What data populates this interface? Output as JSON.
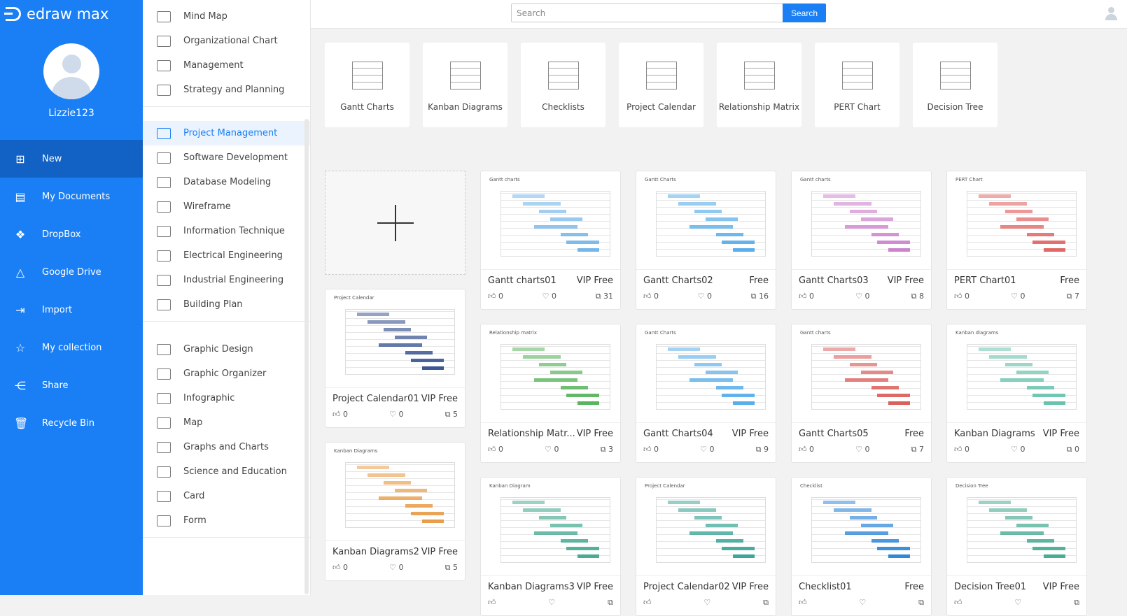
{
  "app": {
    "logo": "edraw max",
    "username": "Lizzie123"
  },
  "nav": [
    {
      "label": "New",
      "icon": "new-file-icon",
      "active": true
    },
    {
      "label": "My Documents",
      "icon": "documents-icon"
    },
    {
      "label": "DropBox",
      "icon": "dropbox-icon"
    },
    {
      "label": "Google Drive",
      "icon": "google-drive-icon"
    },
    {
      "label": "Import",
      "icon": "import-icon"
    },
    {
      "label": "My collection",
      "icon": "star-icon"
    },
    {
      "label": "Share",
      "icon": "share-icon"
    },
    {
      "label": "Recycle Bin",
      "icon": "trash-icon"
    }
  ],
  "categories": [
    [
      "Mind Map",
      "Organizational Chart",
      "Management",
      "Strategy and Planning"
    ],
    [
      "Project Management",
      "Software Development",
      "Database Modeling",
      "Wireframe",
      "Information Technique",
      "Electrical Engineering",
      "Industrial Engineering",
      "Building Plan"
    ],
    [
      "Graphic Design",
      "Graphic Organizer",
      "Infographic",
      "Map",
      "Graphs and Charts",
      "Science and Education",
      "Card",
      "Form"
    ]
  ],
  "active_category": "Project Management",
  "search": {
    "placeholder": "Search",
    "button": "Search"
  },
  "types": [
    "Gantt Charts",
    "Kanban Diagrams",
    "Checklists",
    "Project Calendar",
    "Relationship Matrix",
    "PERT Chart",
    "Decision Tree"
  ],
  "columns": [
    [
      {
        "name": "Project Calendar01",
        "tier": "VIP Free",
        "likes": "0",
        "favs": "0",
        "copies": "5",
        "thumb": "Project Calendar",
        "accent": "#2d4a8a"
      },
      {
        "name": "Kanban Diagrams2",
        "tier": "VIP Free",
        "likes": "0",
        "favs": "0",
        "copies": "5",
        "thumb": "Kanban Diagrams",
        "accent": "#e8963a"
      }
    ],
    [
      {
        "name": "Gantt charts01",
        "tier": "VIP Free",
        "likes": "0",
        "favs": "0",
        "copies": "31",
        "thumb": "Gantt charts",
        "accent": "#6ab0e8"
      },
      {
        "name": "Relationship Matr...",
        "tier": "VIP Free",
        "likes": "0",
        "favs": "0",
        "copies": "3",
        "thumb": "Relationship matrix",
        "accent": "#4caf50"
      },
      {
        "name": "Kanban Diagrams3",
        "tier": "VIP Free",
        "likes": "",
        "favs": "",
        "copies": "",
        "thumb": "Kanban Diagram",
        "accent": "#3aa58a"
      }
    ],
    [
      {
        "name": "Gantt Charts02",
        "tier": "Free",
        "likes": "0",
        "favs": "0",
        "copies": "16",
        "thumb": "Gantt Charts",
        "accent": "#4aa8e8"
      },
      {
        "name": "Gantt Charts04",
        "tier": "VIP Free",
        "likes": "0",
        "favs": "0",
        "copies": "9",
        "thumb": "Gantt Charts",
        "accent": "#4aa8e8"
      },
      {
        "name": "Project Calendar02",
        "tier": "VIP Free",
        "likes": "",
        "favs": "",
        "copies": "",
        "thumb": "Project Calendar",
        "accent": "#2d9f8f"
      }
    ],
    [
      {
        "name": "Gantt Charts03",
        "tier": "VIP Free",
        "likes": "0",
        "favs": "0",
        "copies": "8",
        "thumb": "Gantt charts",
        "accent": "#c97ac9"
      },
      {
        "name": "Gantt Charts05",
        "tier": "Free",
        "likes": "0",
        "favs": "0",
        "copies": "7",
        "thumb": "Gantt charts",
        "accent": "#d9534f"
      },
      {
        "name": "Checklist01",
        "tier": "Free",
        "likes": "",
        "favs": "",
        "copies": "",
        "thumb": "Checklist",
        "accent": "#1f7fd6"
      }
    ],
    [
      {
        "name": "PERT Chart01",
        "tier": "Free",
        "likes": "0",
        "favs": "0",
        "copies": "7",
        "thumb": "PERT Chart",
        "accent": "#e05a5a"
      },
      {
        "name": "Kanban Diagrams",
        "tier": "VIP Free",
        "likes": "0",
        "favs": "0",
        "copies": "0",
        "thumb": "Kanban diagrams",
        "accent": "#5cbfa8"
      },
      {
        "name": "Decision Tree01",
        "tier": "VIP Free",
        "likes": "",
        "favs": "",
        "copies": "",
        "thumb": "Decision Tree",
        "accent": "#3aa58a"
      }
    ]
  ]
}
